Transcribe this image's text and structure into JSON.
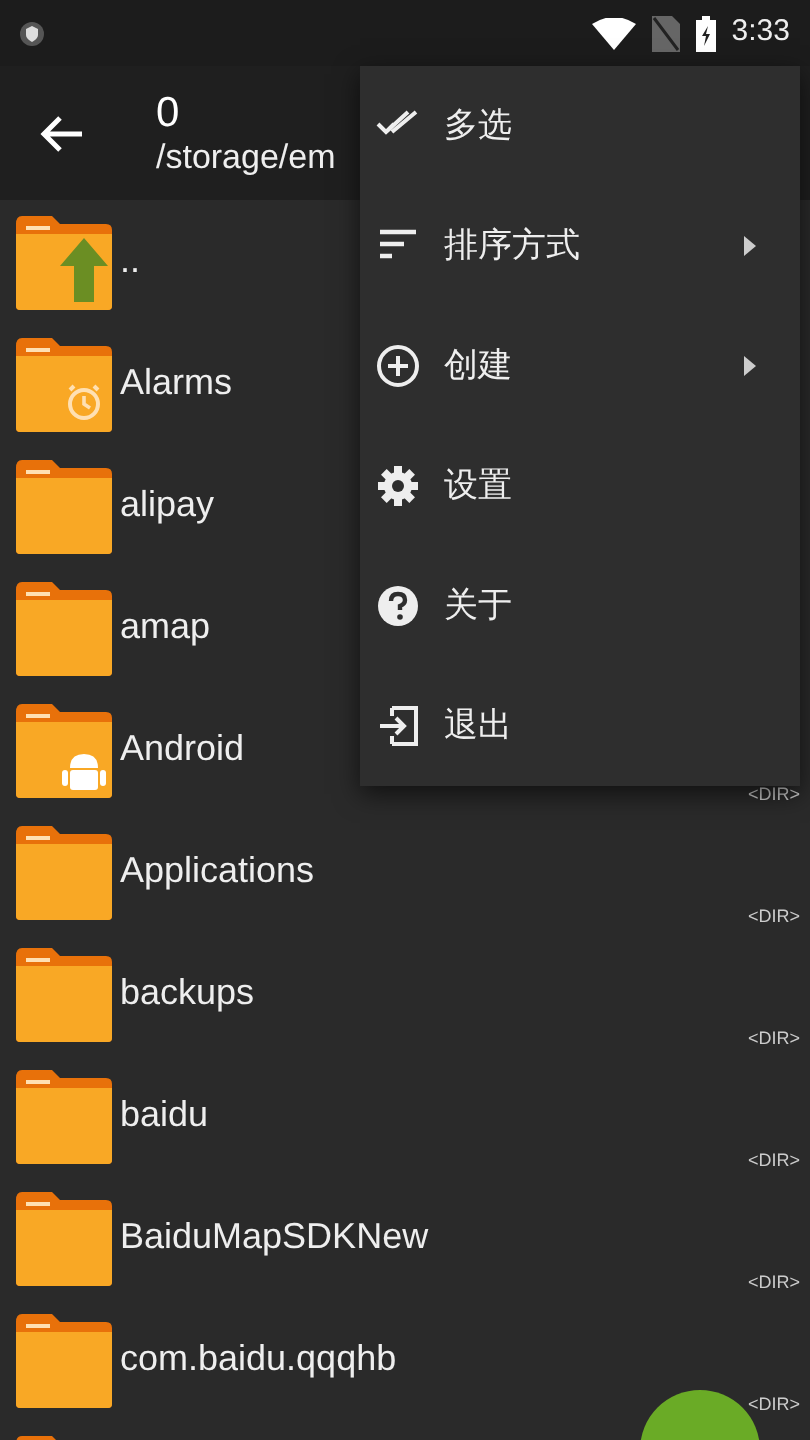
{
  "status_bar": {
    "time": "3:33"
  },
  "app_bar": {
    "title": "0",
    "path": "/storage/em"
  },
  "files": [
    {
      "name": "..",
      "kind": "up"
    },
    {
      "name": "Alarms",
      "kind": "alarm"
    },
    {
      "name": "alipay",
      "kind": "plain"
    },
    {
      "name": "amap",
      "kind": "plain"
    },
    {
      "name": "Android",
      "kind": "android",
      "type": "<DIR>"
    },
    {
      "name": "Applications",
      "kind": "plain",
      "type": "<DIR>"
    },
    {
      "name": "backups",
      "kind": "plain",
      "type": "<DIR>"
    },
    {
      "name": "baidu",
      "kind": "plain",
      "type": "<DIR>"
    },
    {
      "name": "BaiduMapSDKNew",
      "kind": "plain",
      "type": "<DIR>"
    },
    {
      "name": "com.baidu.qqqhb",
      "kind": "plain",
      "type": "<DIR>"
    },
    {
      "kind": "plain"
    }
  ],
  "menu": [
    {
      "label": "多选",
      "kind": "multiselect",
      "submenu": false
    },
    {
      "label": "排序方式",
      "kind": "sort",
      "submenu": true
    },
    {
      "label": "创建",
      "kind": "add",
      "submenu": true
    },
    {
      "label": "设置",
      "kind": "settings",
      "submenu": false
    },
    {
      "label": "关于",
      "kind": "help",
      "submenu": false
    },
    {
      "label": "退出",
      "kind": "exit",
      "submenu": false
    }
  ]
}
